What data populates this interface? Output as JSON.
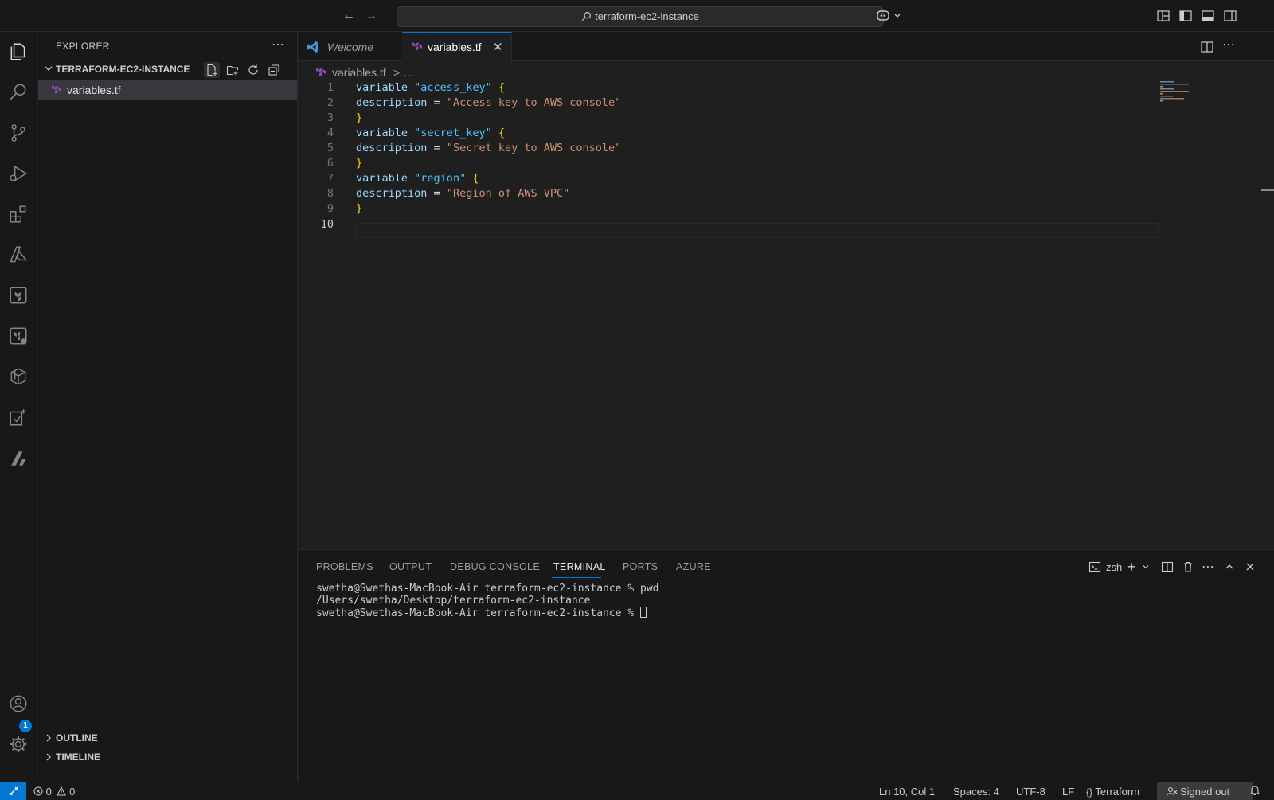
{
  "titlebar": {
    "search_text": "terraform-ec2-instance"
  },
  "activity_bar": {
    "items": [
      "explorer-icon",
      "search-icon",
      "source-control-icon",
      "run-debug-icon",
      "extensions-icon",
      "azure-icon",
      "terraform-icon",
      "terraform-cloud-icon",
      "containers-icon",
      "testing-icon",
      "aws-icon"
    ],
    "accounts_badge": "1"
  },
  "sidebar": {
    "title": "EXPLORER",
    "folder": "TERRAFORM-EC2-INSTANCE",
    "files": [
      "variables.tf"
    ],
    "sections": [
      "OUTLINE",
      "TIMELINE"
    ]
  },
  "tabs": [
    {
      "label": "Welcome",
      "active": false
    },
    {
      "label": "variables.tf",
      "active": true
    }
  ],
  "breadcrumb": {
    "file": "variables.tf",
    "separator": ">",
    "more": "..."
  },
  "editor": {
    "lines": [
      {
        "n": "1",
        "kw": "variable",
        "name": "\"access_key\"",
        "tail": "{"
      },
      {
        "n": "2",
        "attr": "description",
        "eq": "=",
        "str": "\"Access key to AWS console\""
      },
      {
        "n": "3",
        "close": "}"
      },
      {
        "n": "4",
        "kw": "variable",
        "name": "\"secret_key\"",
        "tail": "{"
      },
      {
        "n": "5",
        "attr": "description",
        "eq": "=",
        "str": "\"Secret key to AWS console\""
      },
      {
        "n": "6",
        "close": "}"
      },
      {
        "n": "7",
        "kw": "variable",
        "name": "\"region\"",
        "tail": "{"
      },
      {
        "n": "8",
        "attr": "description",
        "eq": "=",
        "str": "\"Region of AWS VPC\""
      },
      {
        "n": "9",
        "close": "}"
      },
      {
        "n": "10"
      }
    ]
  },
  "panel": {
    "tabs": [
      "PROBLEMS",
      "OUTPUT",
      "DEBUG CONSOLE",
      "TERMINAL",
      "PORTS",
      "AZURE"
    ],
    "active_tab": "TERMINAL",
    "shell": "zsh",
    "terminal_lines": [
      "swetha@Swethas-MacBook-Air terraform-ec2-instance % pwd",
      "/Users/swetha/Desktop/terraform-ec2-instance",
      "swetha@Swethas-MacBook-Air terraform-ec2-instance % "
    ]
  },
  "statusbar": {
    "errors": "0",
    "warnings": "0",
    "position": "Ln 10, Col 1",
    "spaces": "Spaces: 4",
    "encoding": "UTF-8",
    "eol": "LF",
    "language": "Terraform",
    "account": "Signed out"
  },
  "colors": {
    "accent": "#0078d4",
    "terraform": "#844fba"
  }
}
